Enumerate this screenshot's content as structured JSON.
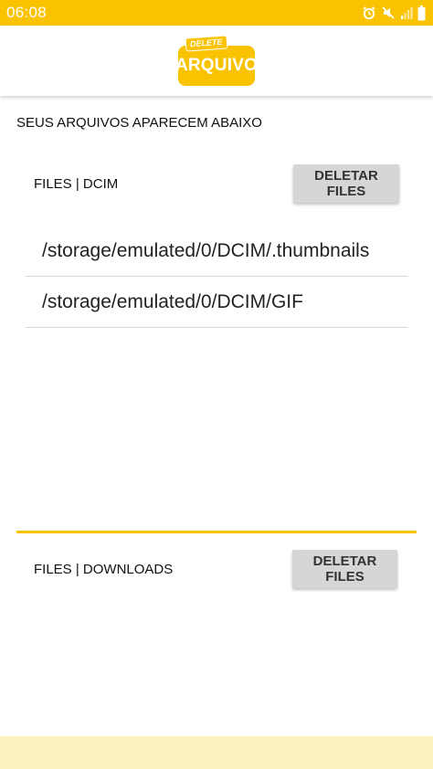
{
  "status_bar": {
    "time": "06:08",
    "icons": [
      "alarm-icon",
      "mute-icon",
      "signal-icon",
      "battery-icon"
    ]
  },
  "app": {
    "logo_tag": "DELETE",
    "logo_text": "ARQUIVO"
  },
  "intro_text": "SEUS ARQUIVOS APARECEM ABAIXO",
  "dcim_section": {
    "label": "FILES | DCIM",
    "delete_button": "DELETAR FILES",
    "files": [
      "/storage/emulated/0/DCIM/.thumbnails",
      "/storage/emulated/0/DCIM/GIF"
    ]
  },
  "downloads_section": {
    "label": "FILES | DOWNLOADS",
    "delete_button": "DELETAR FILES"
  },
  "colors": {
    "accent": "#f9c300",
    "button_bg": "#d6d6d6",
    "bottom_strip": "#fdf1c2"
  }
}
